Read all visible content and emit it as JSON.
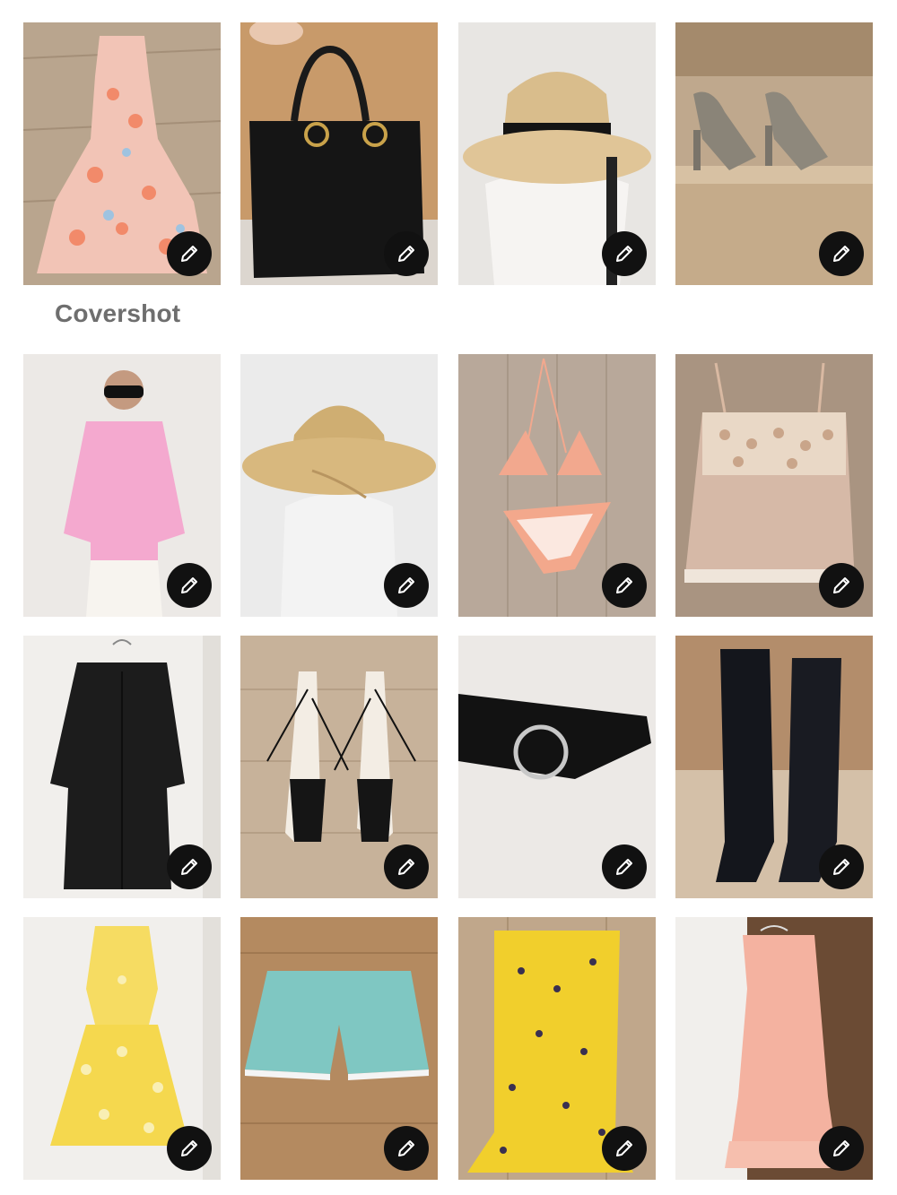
{
  "cover_label": "Covershot",
  "edit_icon": "pencil-icon",
  "colors": {
    "edit_button_bg": "#111111",
    "edit_icon": "#ffffff",
    "label": "#6e6e6e",
    "background": "#ffffff"
  },
  "items": [
    {
      "name": "floral-maxi-dress"
    },
    {
      "name": "black-leather-handbag"
    },
    {
      "name": "straw-fedora-hat"
    },
    {
      "name": "metallic-platform-sandals"
    },
    {
      "name": "pink-button-shirt"
    },
    {
      "name": "straw-sun-hat"
    },
    {
      "name": "peach-bikini"
    },
    {
      "name": "sequin-cami-top"
    },
    {
      "name": "black-wool-coat"
    },
    {
      "name": "black-strappy-sandals"
    },
    {
      "name": "black-suede-belt"
    },
    {
      "name": "black-suede-boots"
    },
    {
      "name": "yellow-floral-dress"
    },
    {
      "name": "aqua-crochet-shorts"
    },
    {
      "name": "yellow-floral-skirt"
    },
    {
      "name": "pink-gingham-dress"
    }
  ]
}
